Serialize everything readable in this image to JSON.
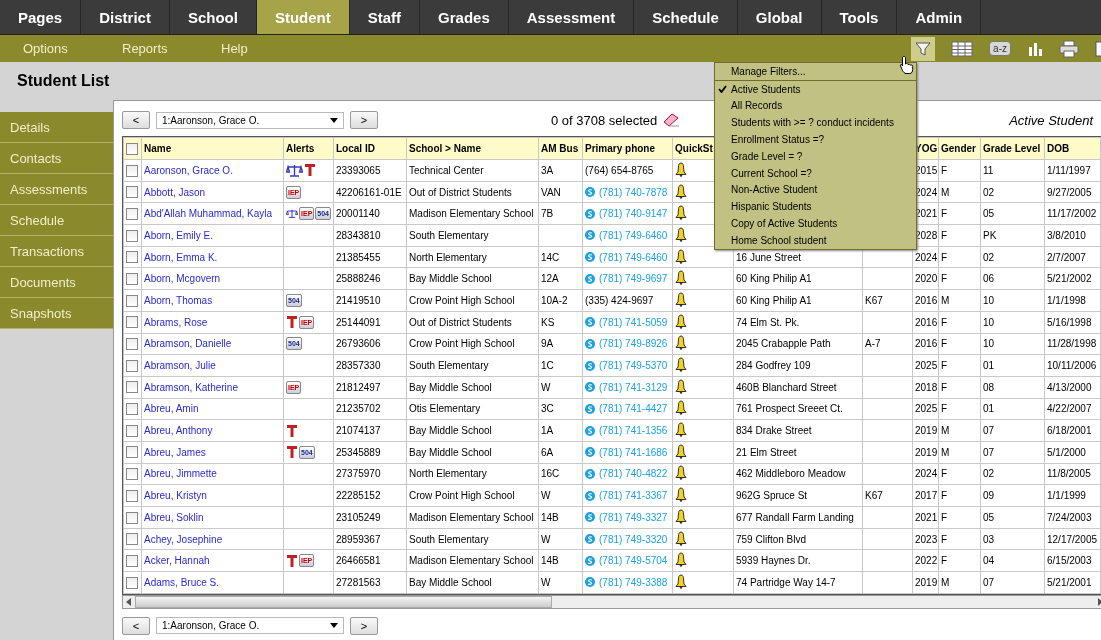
{
  "nav_tabs": [
    {
      "label": "Pages",
      "selected": false
    },
    {
      "label": "District",
      "selected": false
    },
    {
      "label": "School",
      "selected": false
    },
    {
      "label": "Student",
      "selected": true
    },
    {
      "label": "Staff",
      "selected": false
    },
    {
      "label": "Grades",
      "selected": false
    },
    {
      "label": "Assessment",
      "selected": false
    },
    {
      "label": "Schedule",
      "selected": false
    },
    {
      "label": "Global",
      "selected": false
    },
    {
      "label": "Tools",
      "selected": false
    },
    {
      "label": "Admin",
      "selected": false
    }
  ],
  "sub_menu": [
    "Options",
    "Reports",
    "Help"
  ],
  "toolbar": {
    "sort_label": "a-z",
    "filter_active": true
  },
  "page_title": "Student List",
  "side_tabs": [
    "Details",
    "Contacts",
    "Assessments",
    "Schedule",
    "Transactions",
    "Documents",
    "Snapshots"
  ],
  "navigator": {
    "prev": "<",
    "record": "1:Aaronson, Grace O.",
    "next": ">",
    "selection": "0 of 3708 selected",
    "filter_name": "Active Student"
  },
  "navigator_bottom": {
    "prev": "<",
    "record": "1:Aaronson, Grace O.",
    "next": ">"
  },
  "all_checked": false,
  "columns": [
    {
      "label": "Name"
    },
    {
      "label": "Alerts"
    },
    {
      "label": "Local ID"
    },
    {
      "label": "School > Name"
    },
    {
      "label": "AM Bus"
    },
    {
      "label": "Primary phone"
    },
    {
      "label": "QuickSt"
    },
    {},
    {},
    {
      "label": "YOG"
    },
    {
      "label": "Gender"
    },
    {
      "label": "Grade Level"
    },
    {
      "label": "DOB"
    }
  ],
  "rows": [
    {
      "checked": false,
      "name": "Aaronson, Grace O.",
      "alerts": [
        {
          "kind": "legal"
        },
        {
          "kind": "medical"
        }
      ],
      "local_id": "23393065",
      "school": "Technical Center",
      "bus": "3A",
      "phone": "(764) 654-8765",
      "phone_link": false,
      "yog": "2015",
      "gender": "F",
      "grade": "11",
      "dob": "1/11/1997"
    },
    {
      "checked": false,
      "name": "Abbott, Jason",
      "alerts": [
        {
          "kind": "plan",
          "text": "IEP"
        }
      ],
      "local_id": "42206161-01E",
      "school": "Out of District Students",
      "bus": "VAN",
      "phone": "(781) 740-7878",
      "phone_link": true,
      "yog": "2024",
      "gender": "M",
      "grade": "02",
      "dob": "9/27/2005"
    },
    {
      "checked": false,
      "name": "Abd'Allah Muhammad, Kayla",
      "alerts": [
        {
          "kind": "legal"
        },
        {
          "kind": "plan",
          "text": "IEP"
        },
        {
          "kind": "section",
          "text": "504"
        }
      ],
      "local_id": "20001140",
      "school": "Madison Elementary School",
      "bus": "7B",
      "phone": "(781) 740-9147",
      "phone_link": true,
      "yog": "2021",
      "gender": "F",
      "grade": "05",
      "dob": "11/17/2002"
    },
    {
      "checked": false,
      "name": "Aborn, Emily E.",
      "alerts": [],
      "local_id": "28343810",
      "school": "South Elementary",
      "phone": "(781) 749-6460",
      "phone_link": true,
      "yog": "2028",
      "gender": "F",
      "grade": "PK",
      "dob": "3/8/2010"
    },
    {
      "checked": false,
      "name": "Aborn, Emma K.",
      "alerts": [],
      "local_id": "21385455",
      "school": "North Elementary",
      "bus": "14C",
      "phone": "(781) 749-6460",
      "phone_link": true,
      "address": "16 June Street",
      "yog": "2024",
      "gender": "F",
      "grade": "02",
      "dob": "2/7/2007"
    },
    {
      "checked": false,
      "name": "Aborn, Mcgovern",
      "alerts": [],
      "local_id": "25888246",
      "school": "Bay Middle School",
      "bus": "12A",
      "phone": "(781) 749-9697",
      "phone_link": true,
      "address": "60 King Philip A1",
      "yog": "2020",
      "gender": "F",
      "grade": "06",
      "dob": "5/21/2002"
    },
    {
      "checked": false,
      "name": "Aborn, Thomas",
      "alerts": [
        {
          "kind": "section",
          "text": "504"
        }
      ],
      "local_id": "21419510",
      "school": "Crow Point High School",
      "bus": "10A-2",
      "phone": "(335) 424-9697",
      "phone_link": false,
      "address": "60 King Philip A1",
      "column_9": "K67",
      "yog": "2016",
      "gender": "M",
      "grade": "10",
      "dob": "1/1/1998"
    },
    {
      "checked": false,
      "name": "Abrams, Rose",
      "alerts": [
        {
          "kind": "medical"
        },
        {
          "kind": "plan",
          "text": "IEP"
        }
      ],
      "local_id": "25144091",
      "school": "Out of District Students",
      "bus": "KS",
      "phone": "(781) 741-5059",
      "phone_link": true,
      "address": "74 Elm St. Pk.",
      "yog": "2016",
      "gender": "F",
      "grade": "10",
      "dob": "5/16/1998"
    },
    {
      "checked": false,
      "name": "Abramson, Danielle",
      "alerts": [
        {
          "kind": "section",
          "text": "504"
        }
      ],
      "local_id": "26793606",
      "school": "Crow Point High School",
      "bus": "9A",
      "phone": "(781) 749-8926",
      "phone_link": true,
      "address": "2045 Crabapple Path",
      "column_9": "A-7",
      "yog": "2016",
      "gender": "F",
      "grade": "10",
      "dob": "11/28/1998"
    },
    {
      "checked": false,
      "name": "Abramson, Julie",
      "alerts": [],
      "local_id": "28357330",
      "school": "South Elementary",
      "bus": "1C",
      "phone": "(781) 749-5370",
      "phone_link": true,
      "address": "284 Godfrey 109",
      "yog": "2025",
      "gender": "F",
      "grade": "01",
      "dob": "10/11/2006"
    },
    {
      "checked": false,
      "name": "Abramson, Katherine",
      "alerts": [
        {
          "kind": "plan",
          "text": "IEP"
        }
      ],
      "local_id": "21812497",
      "school": "Bay Middle School",
      "bus": "W",
      "phone": "(781) 741-3129",
      "phone_link": true,
      "address": "460B Blanchard Street",
      "yog": "2018",
      "gender": "F",
      "grade": "08",
      "dob": "4/13/2000"
    },
    {
      "checked": false,
      "name": "Abreu, Amin",
      "alerts": [],
      "local_id": "21235702",
      "school": "Otis Elementary",
      "bus": "3C",
      "phone": "(781) 741-4427",
      "phone_link": true,
      "address": "761 Prospect Sreeet Ct.",
      "yog": "2025",
      "gender": "F",
      "grade": "01",
      "dob": "4/22/2007"
    },
    {
      "checked": false,
      "name": "Abreu, Anthony",
      "alerts": [
        {
          "kind": "medical"
        }
      ],
      "local_id": "21074137",
      "school": "Bay Middle School",
      "bus": "1A",
      "phone": "(781) 741-1356",
      "phone_link": true,
      "address": "834 Drake Street",
      "yog": "2019",
      "gender": "M",
      "grade": "07",
      "dob": "6/18/2001"
    },
    {
      "checked": false,
      "name": "Abreu, James",
      "alerts": [
        {
          "kind": "medical"
        },
        {
          "kind": "section",
          "text": "504"
        }
      ],
      "local_id": "25345889",
      "school": "Bay Middle School",
      "bus": "6A",
      "phone": "(781) 741-1686",
      "phone_link": true,
      "address": "21 Elm Street",
      "yog": "2019",
      "gender": "M",
      "grade": "07",
      "dob": "5/1/2000"
    },
    {
      "checked": false,
      "name": "Abreu, Jimmette",
      "alerts": [],
      "local_id": "27375970",
      "school": "North Elementary",
      "bus": "16C",
      "phone": "(781) 740-4822",
      "phone_link": true,
      "address": "462 Middleboro Meadow",
      "yog": "2024",
      "gender": "F",
      "grade": "02",
      "dob": "11/8/2005"
    },
    {
      "checked": false,
      "name": "Abreu, Kristyn",
      "alerts": [],
      "local_id": "22285152",
      "school": "Crow Point High School",
      "bus": "W",
      "phone": "(781) 741-3367",
      "phone_link": true,
      "address": "962G Spruce St",
      "column_9": "K67",
      "yog": "2017",
      "gender": "F",
      "grade": "09",
      "dob": "1/1/1999"
    },
    {
      "checked": false,
      "name": "Abreu, Soklin",
      "alerts": [],
      "local_id": "23105249",
      "school": "Madison Elementary School",
      "bus": "14B",
      "phone": "(781) 749-3327",
      "phone_link": true,
      "address": "677 Randall Farm Landing",
      "yog": "2021",
      "gender": "F",
      "grade": "05",
      "dob": "7/24/2003"
    },
    {
      "checked": false,
      "name": "Achey, Josephine",
      "alerts": [],
      "local_id": "28959367",
      "school": "South Elementary",
      "bus": "W",
      "phone": "(781) 749-3320",
      "phone_link": true,
      "address": "759 Clifton Blvd",
      "yog": "2023",
      "gender": "F",
      "grade": "03",
      "dob": "12/17/2005"
    },
    {
      "checked": false,
      "name": "Acker, Hannah",
      "alerts": [
        {
          "kind": "medical"
        },
        {
          "kind": "plan",
          "text": "IEP"
        }
      ],
      "local_id": "26466581",
      "school": "Madison Elementary School",
      "bus": "14B",
      "phone": "(781) 749-5704",
      "phone_link": true,
      "address": "5939 Haynes Dr.",
      "yog": "2022",
      "gender": "F",
      "grade": "04",
      "dob": "6/15/2003"
    },
    {
      "checked": false,
      "name": "Adams, Bruce S.",
      "alerts": [],
      "local_id": "27281563",
      "school": "Bay Middle School",
      "bus": "W",
      "phone": "(781) 749-3388",
      "phone_link": true,
      "address": "74 Partridge Way 14-7",
      "yog": "2019",
      "gender": "M",
      "grade": "07",
      "dob": "5/21/2001"
    }
  ],
  "filter_menu": {
    "manage_label": "Manage Filters...",
    "items": [
      {
        "label": "Active Students",
        "checked": true
      },
      {
        "label": "All Records",
        "checked": false
      },
      {
        "label": "Students with >= ? conduct incidents",
        "checked": false
      },
      {
        "label": "Enrollment Status =?",
        "checked": false
      },
      {
        "label": "Grade Level = ?",
        "checked": false
      },
      {
        "label": "Current School =?",
        "checked": false
      },
      {
        "label": "Non-Active Student",
        "checked": false
      },
      {
        "label": "Hispanic Students",
        "checked": false
      },
      {
        "label": "Copy of Active Students",
        "checked": false
      },
      {
        "label": "Home School student",
        "checked": false
      }
    ]
  }
}
